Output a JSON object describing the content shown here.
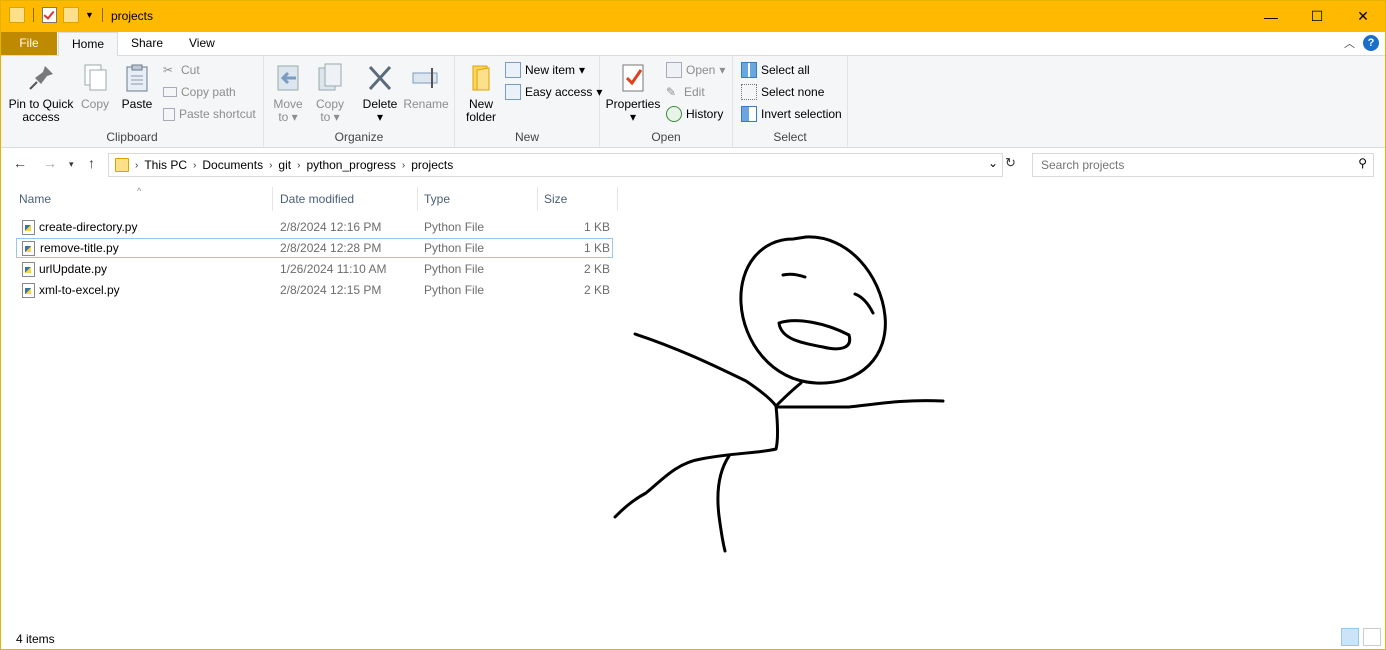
{
  "window": {
    "title": "projects",
    "controls": {
      "minimize": "—",
      "maximize": "☐",
      "close": "✕"
    }
  },
  "ribbon_tabs": {
    "file": "File",
    "home": "Home",
    "share": "Share",
    "view": "View"
  },
  "ribbon": {
    "clipboard": {
      "label": "Clipboard",
      "pin_line1": "Pin to Quick",
      "pin_line2": "access",
      "copy": "Copy",
      "paste": "Paste",
      "cut": "Cut",
      "copy_path": "Copy path",
      "paste_shortcut": "Paste shortcut"
    },
    "organize": {
      "label": "Organize",
      "move_line1": "Move",
      "move_line2": "to",
      "copy_line1": "Copy",
      "copy_line2": "to",
      "delete": "Delete",
      "rename": "Rename"
    },
    "new": {
      "label": "New",
      "folder_line1": "New",
      "folder_line2": "folder",
      "new_item": "New item",
      "easy_access": "Easy access"
    },
    "open": {
      "label": "Open",
      "properties": "Properties",
      "open": "Open",
      "edit": "Edit",
      "history": "History"
    },
    "select": {
      "label": "Select",
      "select_all": "Select all",
      "select_none": "Select none",
      "invert": "Invert selection"
    }
  },
  "address": {
    "crumbs": [
      "This PC",
      "Documents",
      "git",
      "python_progress",
      "projects"
    ]
  },
  "search": {
    "placeholder": "Search projects"
  },
  "columns": {
    "name": "Name",
    "date": "Date modified",
    "type": "Type",
    "size": "Size"
  },
  "files": [
    {
      "name": "create-directory.py",
      "date": "2/8/2024 12:16 PM",
      "type": "Python File",
      "size": "1 KB"
    },
    {
      "name": "remove-title.py",
      "date": "2/8/2024 12:28 PM",
      "type": "Python File",
      "size": "1 KB"
    },
    {
      "name": "urlUpdate.py",
      "date": "1/26/2024 11:10 AM",
      "type": "Python File",
      "size": "2 KB"
    },
    {
      "name": "xml-to-excel.py",
      "date": "2/8/2024 12:15 PM",
      "type": "Python File",
      "size": "2 KB"
    }
  ],
  "status": {
    "count": "4 items"
  },
  "colors": {
    "titlebar": "#ffb900",
    "file_tab": "#c08a00",
    "accent": "#1a6fc9"
  }
}
